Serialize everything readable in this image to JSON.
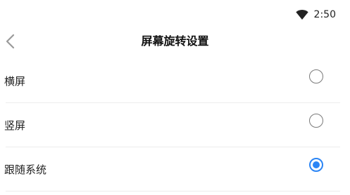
{
  "status_bar": {
    "time": "2:50",
    "wifi_icon": "wifi-icon"
  },
  "header": {
    "back_icon": "chevron-left-icon",
    "title": "屏幕旋转设置"
  },
  "options": [
    {
      "label": "横屏",
      "selected": false
    },
    {
      "label": "竖屏",
      "selected": false
    },
    {
      "label": "跟随系统",
      "selected": true
    }
  ],
  "colors": {
    "accent": "#2b85f5",
    "radio_border": "#7a7a7a",
    "divider": "#ececec",
    "back_icon": "#9a9a9a"
  }
}
